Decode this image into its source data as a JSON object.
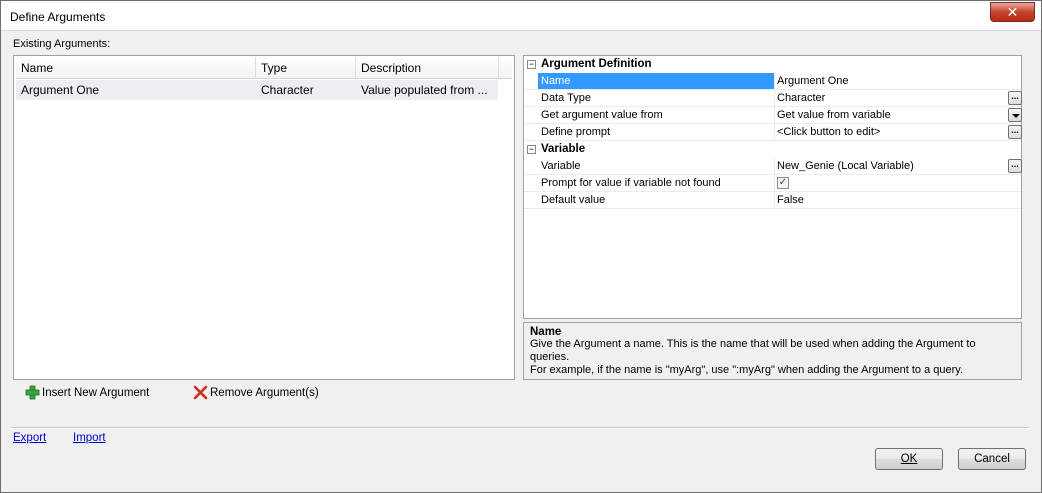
{
  "window": {
    "title": "Define Arguments",
    "close_glyph": "✕"
  },
  "left": {
    "label": "Existing Arguments:",
    "columns": [
      "Name",
      "Type",
      "Description"
    ],
    "rows": [
      {
        "name": "Argument One",
        "type": "Character",
        "description": "Value populated from ..."
      }
    ]
  },
  "actions": {
    "insert": "Insert New Argument",
    "remove": "Remove Argument(s)"
  },
  "properties": {
    "categories": [
      {
        "title": "Argument Definition",
        "toggle": "−",
        "rows": [
          {
            "label": "Name",
            "value": "Argument One"
          },
          {
            "label": "Data Type",
            "value": "Character",
            "button": "..."
          },
          {
            "label": "Get argument value from",
            "value": "Get value from variable"
          },
          {
            "label": "Define prompt",
            "value": "<Click button to edit>",
            "button": "..."
          }
        ]
      },
      {
        "title": "Variable",
        "toggle": "−",
        "rows": [
          {
            "label": "Variable",
            "value": "New_Genie (Local Variable)",
            "button": "..."
          },
          {
            "label": "Prompt for value if variable not found",
            "checked": "✓"
          },
          {
            "label": "Default value",
            "value": "False"
          }
        ]
      }
    ]
  },
  "help": {
    "title": "Name",
    "line1": "Give the Argument a name.  This is the name that will be used when adding the Argument to queries.",
    "line2": "For example, if the name is \"myArg\", use \":myArg\" when adding the Argument to a query."
  },
  "footer": {
    "export": "Export",
    "import": "Import",
    "ok": "OK",
    "cancel": "Cancel"
  },
  "colors": {
    "selection": "#3399ff",
    "link": "#0000cc",
    "insert_icon": "#3aa53a",
    "remove_icon": "#d12a1f"
  }
}
